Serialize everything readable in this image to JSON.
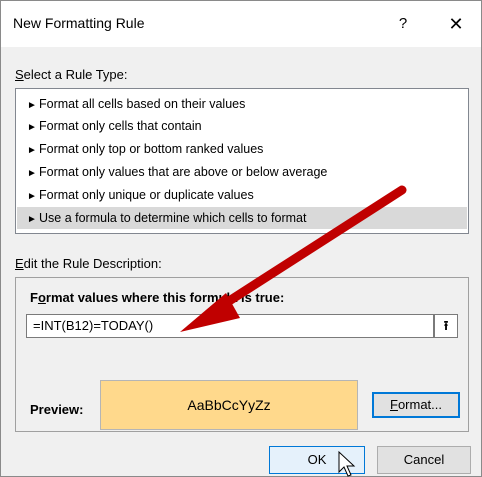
{
  "dialog": {
    "title": "New Formatting Rule",
    "help_glyph": "?",
    "close_glyph": "✕"
  },
  "rule_type": {
    "label_accel": "S",
    "label_rest": "elect a Rule Type:",
    "items": [
      {
        "label": "Format all cells based on their values",
        "selected": false
      },
      {
        "label": "Format only cells that contain",
        "selected": false
      },
      {
        "label": "Format only top or bottom ranked values",
        "selected": false
      },
      {
        "label": "Format only values that are above or below average",
        "selected": false
      },
      {
        "label": "Format only unique or duplicate values",
        "selected": false
      },
      {
        "label": "Use a formula to determine which cells to format",
        "selected": true
      }
    ],
    "bullet": "►"
  },
  "description": {
    "label_accel": "E",
    "label_rest": "dit the Rule Description:",
    "formula_label_pre": "F",
    "formula_label_accel": "o",
    "formula_label_rest": "rmat values where this formula is true:",
    "formula_value": "=INT(B12)=TODAY()",
    "collapse_glyph": "⭱",
    "preview_label": "Preview:",
    "preview_text": "AaBbCcYyZz",
    "format_accel": "F",
    "format_rest": "ormat..."
  },
  "buttons": {
    "ok": "OK",
    "cancel": "Cancel"
  },
  "colors": {
    "preview_fill": "#ffd98c",
    "arrow": "#c00000",
    "focus_border": "#0078d7"
  }
}
